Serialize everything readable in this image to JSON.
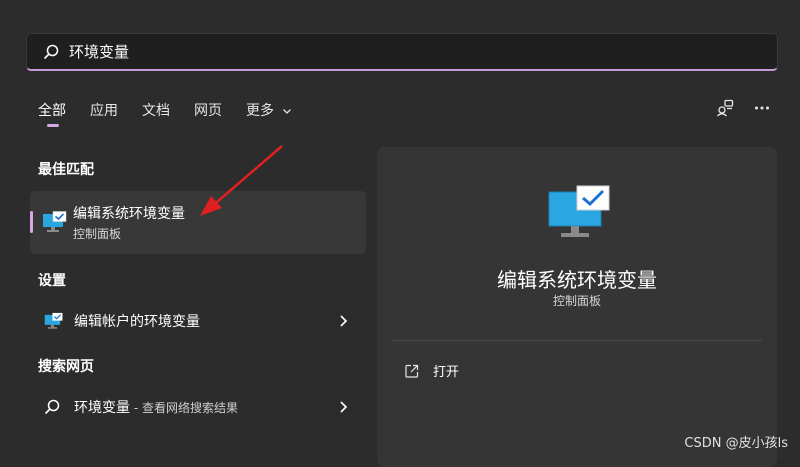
{
  "search": {
    "query": "环境变量"
  },
  "tabs": [
    {
      "label": "全部"
    },
    {
      "label": "应用"
    },
    {
      "label": "文档"
    },
    {
      "label": "网页"
    },
    {
      "label": "更多"
    }
  ],
  "best_match": {
    "header": "最佳匹配",
    "title": "编辑系统环境变量",
    "subtitle": "控制面板"
  },
  "settings": {
    "header": "设置",
    "item": "编辑帐户的环境变量"
  },
  "web_search": {
    "header": "搜索网页",
    "item": "环境变量",
    "suffix": " - 查看网络搜索结果"
  },
  "preview": {
    "title": "编辑系统环境变量",
    "subtitle": "控制面板",
    "action": "打开"
  },
  "watermark": "CSDN @皮小孩ls",
  "colors": {
    "accent": "#d7a8e6",
    "arrow": "#e02020",
    "monitor": "#2aa7e0"
  }
}
